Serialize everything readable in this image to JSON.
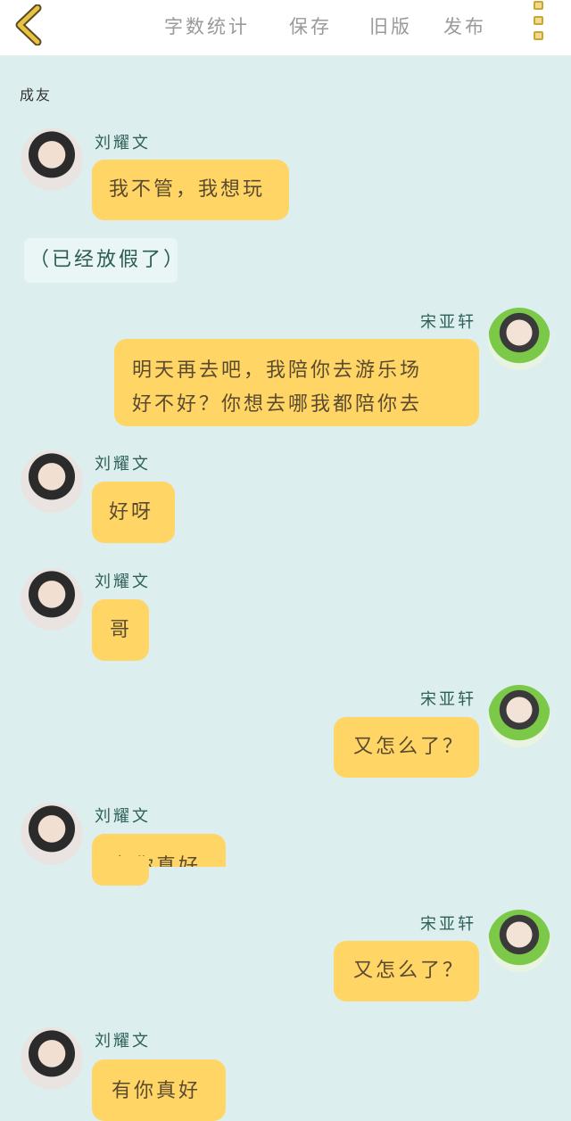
{
  "toolbar": {
    "back_icon": "chevron-left-icon",
    "word_count": "字数统计",
    "save": "保存",
    "old_version": "旧版",
    "publish": "发布",
    "more_icon": "more-menu-icon",
    "accent": "#e7c344"
  },
  "chat": {
    "group_name": "成友",
    "messages": [
      {
        "sender": "刘耀文",
        "side": "left",
        "text": "我不管，我想玩"
      },
      {
        "note": "（已经放假了）"
      },
      {
        "sender": "宋亚轩",
        "side": "right",
        "lines": [
          "明天再去吧，我陪你去游乐场",
          "好不好？你想去哪我都陪你去"
        ]
      },
      {
        "sender": "刘耀文",
        "side": "left",
        "text": "好呀"
      },
      {
        "sender": "刘耀文",
        "side": "left",
        "text": "哥"
      },
      {
        "sender": "宋亚轩",
        "side": "right",
        "text": "又怎么了？"
      },
      {
        "sender": "刘耀文",
        "side": "left",
        "text": "有你真好"
      },
      {
        "sender": "宋亚轩",
        "side": "right",
        "text": "又怎么了？"
      },
      {
        "sender": "刘耀文",
        "side": "left",
        "text": "有你真好"
      }
    ]
  },
  "colors": {
    "background": "#dcefee",
    "bubble": "#ffd565",
    "name": "#2f5f59"
  }
}
